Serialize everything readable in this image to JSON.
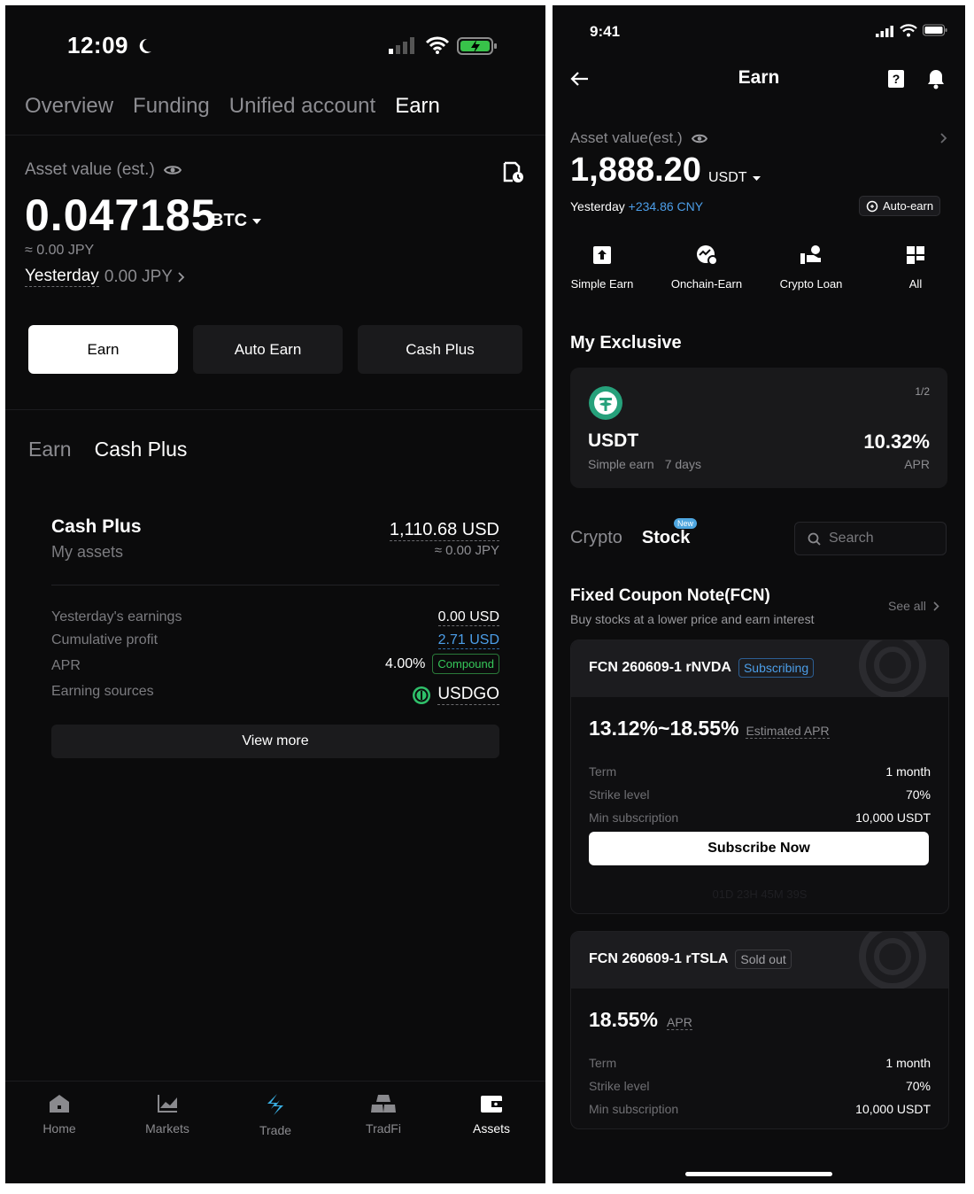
{
  "left": {
    "status": {
      "time": "12:09"
    },
    "tabs": [
      {
        "label": "Overview"
      },
      {
        "label": "Funding"
      },
      {
        "label": "Unified account"
      },
      {
        "label": "Earn",
        "active": true
      }
    ],
    "asset": {
      "label": "Asset value (est.)",
      "value": "0.047185",
      "unit": "BTC",
      "approx": "≈ 0.00 JPY",
      "yesterday_label": "Yesterday",
      "yesterday_value": "0.00 JPY"
    },
    "buttons": [
      {
        "label": "Earn",
        "active": true
      },
      {
        "label": "Auto Earn"
      },
      {
        "label": "Cash Plus"
      }
    ],
    "subtabs": [
      {
        "label": "Earn"
      },
      {
        "label": "Cash Plus",
        "active": true
      }
    ],
    "cash_plus": {
      "title": "Cash Plus",
      "subtitle": "My assets",
      "value": "1,110.68 USD",
      "approx": "≈ 0.00 JPY",
      "rows": {
        "yesterday_label": "Yesterday's earnings",
        "yesterday_value": "0.00 USD",
        "cumulative_label": "Cumulative profit",
        "cumulative_value": "2.71 USD",
        "apr_label": "APR",
        "apr_value": "4.00%",
        "compound_badge": "Compound",
        "sources_label": "Earning sources",
        "sources_value": "USDGO"
      },
      "view_more": "View more"
    },
    "nav": [
      {
        "label": "Home",
        "icon": "home-icon"
      },
      {
        "label": "Markets",
        "icon": "chart-icon"
      },
      {
        "label": "Trade",
        "icon": "trade-icon"
      },
      {
        "label": "TradFi",
        "icon": "tradfi-icon"
      },
      {
        "label": "Assets",
        "icon": "wallet-icon",
        "active": true
      }
    ],
    "colors": {
      "accent_trade": "#3ab1e6",
      "compound_green": "#36c85a"
    }
  },
  "right": {
    "status": {
      "time": "9:41"
    },
    "title": "Earn",
    "asset": {
      "label": "Asset value(est.)",
      "value": "1,888.20",
      "unit": "USDT",
      "yesterday_label": "Yesterday",
      "yesterday_value": "+234.86 CNY",
      "auto_earn": "Auto-earn"
    },
    "quick": [
      {
        "label": "Simple Earn",
        "icon": "simple-earn-icon"
      },
      {
        "label": "Onchain-Earn",
        "icon": "onchain-earn-icon"
      },
      {
        "label": "Crypto Loan",
        "icon": "crypto-loan-icon"
      },
      {
        "label": "All",
        "icon": "grid-icon"
      }
    ],
    "exclusive": {
      "heading": "My Exclusive",
      "pager": "1/2",
      "coin": "USDT",
      "product": "Simple earn",
      "duration": "7 days",
      "rate": "10.32%",
      "rate_label": "APR"
    },
    "tabs": [
      {
        "label": "Crypto"
      },
      {
        "label": "Stock",
        "active": true,
        "badge": "New"
      }
    ],
    "search_placeholder": "Search",
    "fcn": {
      "title": "Fixed Coupon Note(FCN)",
      "subtitle": "Buy stocks at a lower price and earn interest",
      "see_all": "See all",
      "cards": [
        {
          "name": "FCN 260609-1 rNVDA",
          "status": "Subscribing",
          "rate": "13.12%~18.55%",
          "rate_label": "Estimated APR",
          "term_label": "Term",
          "term": "1 month",
          "strike_label": "Strike level",
          "strike": "70%",
          "min_label": "Min subscription",
          "min": "10,000 USDT",
          "cta": "Subscribe Now",
          "countdown": "01D 23H 45M 39S"
        },
        {
          "name": "FCN 260609-1 rTSLA",
          "status": "Sold out",
          "rate": "18.55%",
          "rate_label": "APR",
          "term_label": "Term",
          "term": "1 month",
          "strike_label": "Strike level",
          "strike": "70%",
          "min_label": "Min subscription",
          "min": "10,000 USDT"
        }
      ]
    },
    "colors": {
      "tether_green": "#26a17b",
      "link_blue": "#4c9ee8"
    }
  }
}
